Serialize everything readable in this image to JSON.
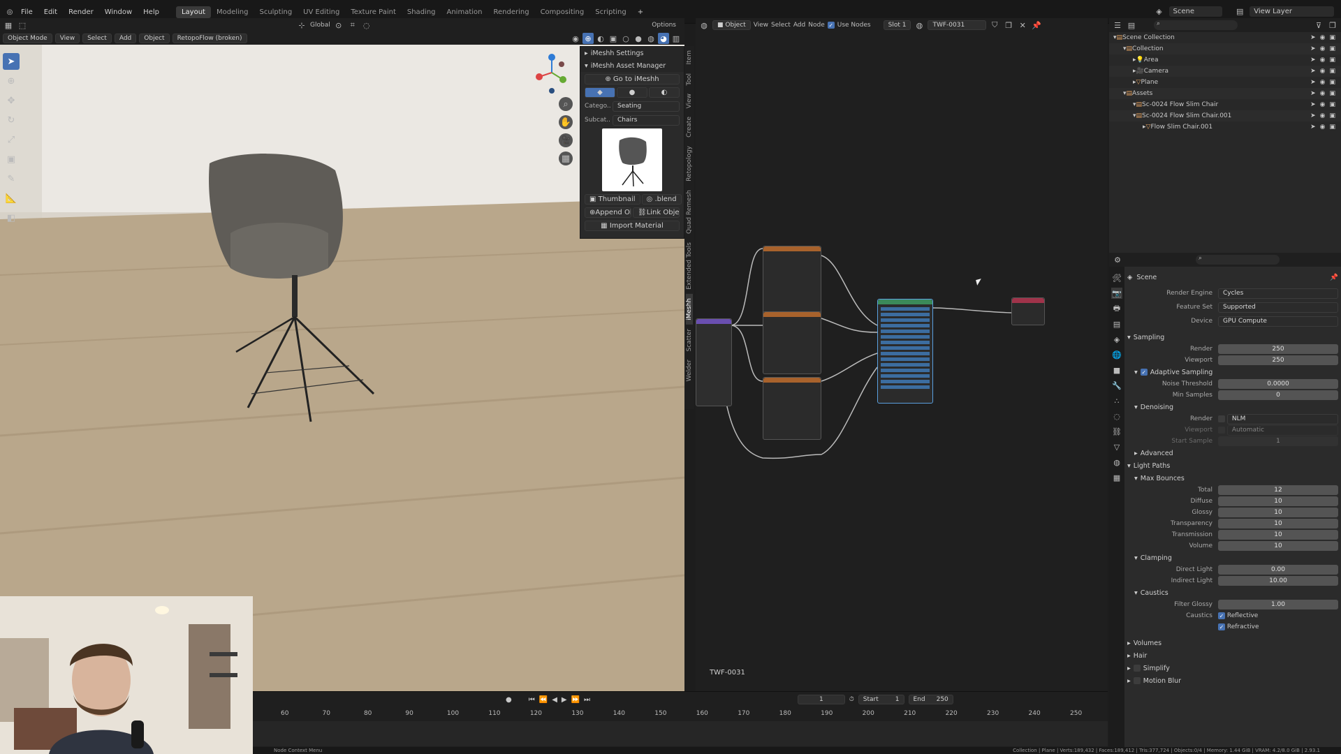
{
  "topbar": {
    "menus": [
      "File",
      "Edit",
      "Render",
      "Window",
      "Help"
    ],
    "workspaces": [
      "Layout",
      "Modeling",
      "Sculpting",
      "UV Editing",
      "Texture Paint",
      "Shading",
      "Animation",
      "Rendering",
      "Compositing",
      "Scripting"
    ],
    "active_workspace": "Layout",
    "scene": "Scene",
    "view_layer": "View Layer"
  },
  "viewport": {
    "mode": "Object Mode",
    "menus": [
      "View",
      "Select",
      "Add",
      "Object"
    ],
    "addon": "RetopoFlow (broken)",
    "transform": "Global",
    "options": "Options"
  },
  "imeshh": {
    "settings_title": "iMeshh Settings",
    "manager_title": "iMeshh Asset Manager",
    "goto": "Go to iMeshh",
    "category_label": "Catego..",
    "category_value": "Seating",
    "subcat_label": "Subcat..",
    "subcat_value": "Chairs",
    "thumbnail_btn": "Thumbnail",
    "blend_btn": ".blend",
    "append_btn": "Append Ob..",
    "link_btn": "Link Object",
    "import_btn": "Import Material",
    "side_tabs": [
      "Item",
      "Tool",
      "View",
      "Create",
      "Retopology",
      "Quad Remesh",
      "Extended Tools",
      "iMeshh",
      "Scatter",
      "Welder"
    ]
  },
  "node_editor": {
    "editor_type": "Object",
    "menus": [
      "View",
      "Select",
      "Add",
      "Node"
    ],
    "use_nodes": "Use Nodes",
    "slot": "Slot 1",
    "material": "TWF-0031",
    "footer_label": "TWF-0031"
  },
  "timeline": {
    "ticks": [
      "60",
      "70",
      "80",
      "90",
      "100",
      "110",
      "120",
      "130",
      "140",
      "150",
      "160",
      "170",
      "180",
      "190",
      "200",
      "210",
      "220",
      "230",
      "240",
      "250"
    ],
    "current_frame": "1",
    "start_label": "Start",
    "start": "1",
    "end_label": "End",
    "end": "250"
  },
  "outliner": {
    "items": [
      {
        "label": "Scene Collection",
        "depth": 0
      },
      {
        "label": "Collection",
        "depth": 1
      },
      {
        "label": "Area",
        "depth": 2
      },
      {
        "label": "Camera",
        "depth": 2
      },
      {
        "label": "Plane",
        "depth": 2
      },
      {
        "label": "Assets",
        "depth": 1
      },
      {
        "label": "Sc-0024 Flow Slim Chair",
        "depth": 2
      },
      {
        "label": "Sc-0024 Flow Slim Chair.001",
        "depth": 2
      },
      {
        "label": "Flow Slim Chair.001",
        "depth": 3
      }
    ]
  },
  "properties": {
    "context": "Scene",
    "render_engine_label": "Render Engine",
    "render_engine": "Cycles",
    "feature_set_label": "Feature Set",
    "feature_set": "Supported",
    "device_label": "Device",
    "device": "GPU Compute",
    "sampling": "Sampling",
    "render_label": "Render",
    "render_samples": "250",
    "viewport_label": "Viewport",
    "viewport_samples": "250",
    "adaptive": "Adaptive Sampling",
    "noise_label": "Noise Threshold",
    "noise": "0.0000",
    "min_samples_label": "Min Samples",
    "min_samples": "0",
    "denoising": "Denoising",
    "denoise_render_label": "Render",
    "denoise_render": "NLM",
    "denoise_viewport_label": "Viewport",
    "denoise_viewport": "Automatic",
    "start_sample_label": "Start Sample",
    "start_sample": "1",
    "advanced": "Advanced",
    "light_paths": "Light Paths",
    "max_bounces": "Max Bounces",
    "bounces": [
      {
        "label": "Total",
        "value": "12"
      },
      {
        "label": "Diffuse",
        "value": "10"
      },
      {
        "label": "Glossy",
        "value": "10"
      },
      {
        "label": "Transparency",
        "value": "10"
      },
      {
        "label": "Transmission",
        "value": "10"
      },
      {
        "label": "Volume",
        "value": "10"
      }
    ],
    "clamping": "Clamping",
    "direct_label": "Direct Light",
    "direct": "0.00",
    "indirect_label": "Indirect Light",
    "indirect": "10.00",
    "caustics": "Caustics",
    "filter_glossy_label": "Filter Glossy",
    "filter_glossy": "1.00",
    "caustics_label": "Caustics",
    "reflective": "Reflective",
    "refractive": "Refractive",
    "volumes": "Volumes",
    "hair": "Hair",
    "simplify": "Simplify",
    "motion_blur": "Motion Blur"
  },
  "status": {
    "left": "Node Context Menu",
    "right": "Collection | Plane | Verts:189,432 | Faces:189,412 | Tris:377,724 | Objects:0/4 | Memory: 1.44 GiB | VRAM: 4.2/8.0 GiB | 2.93.1"
  },
  "colors": {
    "accent": "#4772b3",
    "panel": "#232323",
    "bg": "#1d1d1d"
  }
}
